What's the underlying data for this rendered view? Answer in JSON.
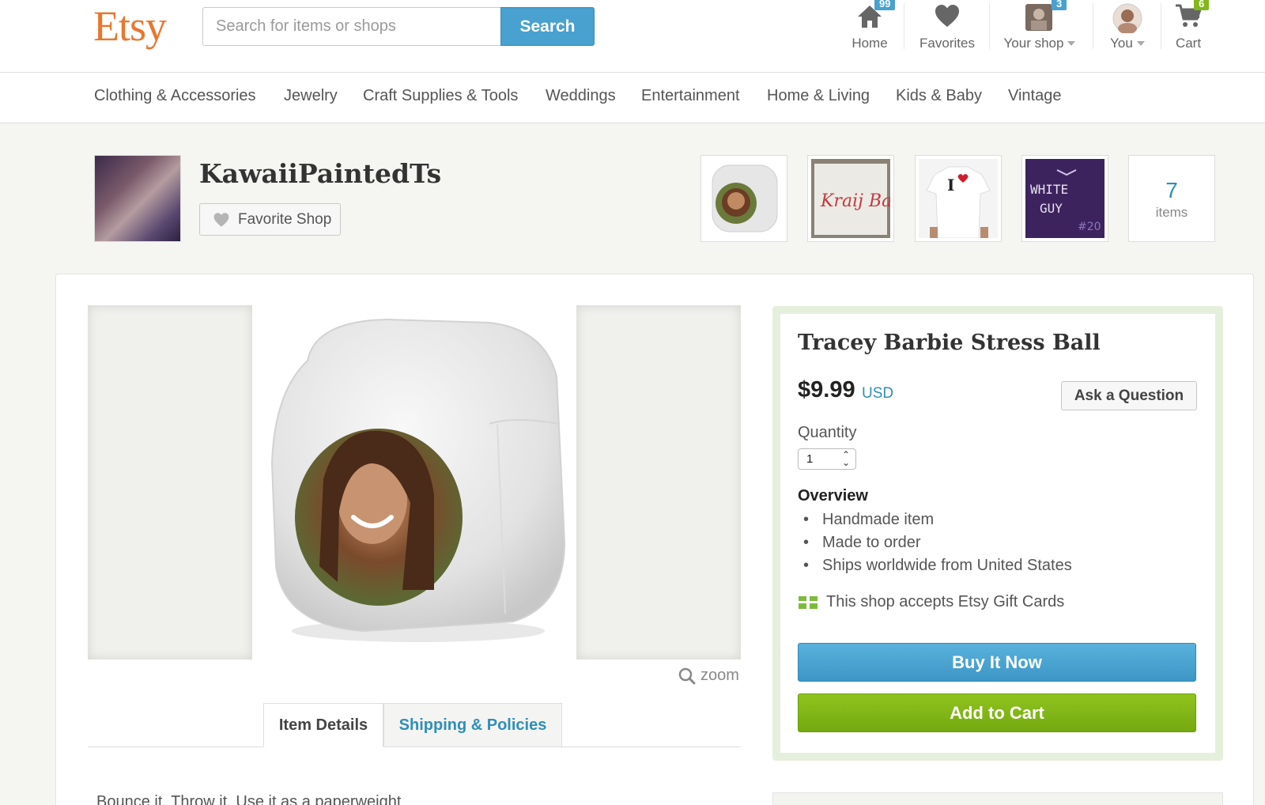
{
  "header": {
    "logo": "Etsy",
    "search_placeholder": "Search for items or shops",
    "search_button": "Search",
    "nav": {
      "home": {
        "label": "Home",
        "badge": "99"
      },
      "favorites": {
        "label": "Favorites"
      },
      "your_shop": {
        "label": "Your shop",
        "badge": "3"
      },
      "you": {
        "label": "You"
      },
      "cart": {
        "label": "Cart",
        "badge": "6"
      }
    }
  },
  "categories": [
    "Clothing & Accessories",
    "Jewelry",
    "Craft Supplies & Tools",
    "Weddings",
    "Entertainment",
    "Home & Living",
    "Kids & Baby",
    "Vintage"
  ],
  "shop": {
    "name": "KawaiiPaintedTs",
    "favorite_button": "Favorite Shop",
    "items_count": "7",
    "items_word": "items",
    "thumbnails": [
      {
        "icon": "stress-cube-thumb"
      },
      {
        "icon": "shirt-text-thumb",
        "text": "Kraij Barkie"
      },
      {
        "icon": "i-heart-shirt-thumb",
        "text": "I"
      },
      {
        "icon": "white-guy-shirt-thumb",
        "text1": "WHITE",
        "text2": "GUY",
        "text3": "#20"
      }
    ]
  },
  "gallery": {
    "zoom_label": "zoom"
  },
  "tabs": {
    "item_details": "Item Details",
    "shipping": "Shipping & Policies"
  },
  "description_peek": "Bounce it. Throw it. Use it as a paperweight",
  "listing": {
    "title": "Tracey Barbie Stress Ball",
    "price": "$9.99",
    "currency": "USD",
    "ask_button": "Ask a Question",
    "quantity_label": "Quantity",
    "quantity_value": "1",
    "overview_heading": "Overview",
    "overview": [
      "Handmade item",
      "Made to order",
      "Ships worldwide from United States"
    ],
    "gift_cards": "This shop accepts Etsy Gift Cards",
    "buy_now": "Buy It Now",
    "add_to_cart": "Add to Cart"
  },
  "colors": {
    "brand": "#e8772e",
    "link_blue": "#2f8fb8",
    "buy_blue": "#48a1cf",
    "cart_green": "#82b81a",
    "buybox_border": "#e4f0dc"
  }
}
